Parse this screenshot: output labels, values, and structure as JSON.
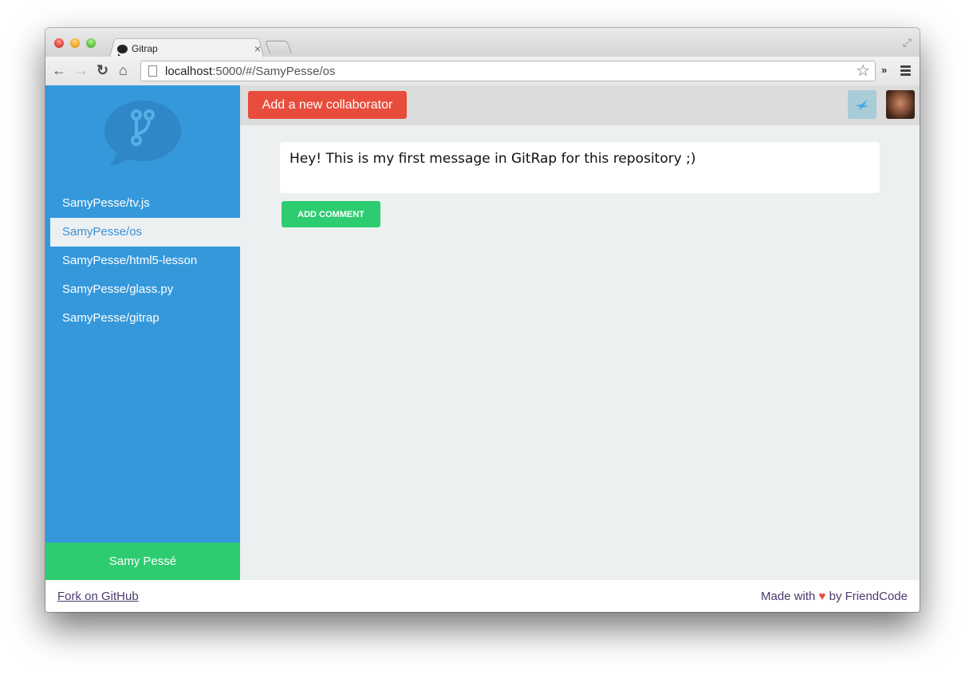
{
  "browser": {
    "tab_title": "Gitrap",
    "tab_close": "×",
    "url_host": "localhost",
    "url_rest": ":5000/#/SamyPesse/os",
    "icons": {
      "back": "←",
      "forward": "→",
      "reload": "↻",
      "home": "⌂",
      "star": "☆",
      "extensions": "»",
      "fullscreen": "⤢"
    }
  },
  "sidebar": {
    "repos": [
      {
        "label": "SamyPesse/tv.js",
        "active": false
      },
      {
        "label": "SamyPesse/os",
        "active": true
      },
      {
        "label": "SamyPesse/html5-lesson",
        "active": false
      },
      {
        "label": "SamyPesse/glass.py",
        "active": false
      },
      {
        "label": "SamyPesse/gitrap",
        "active": false
      }
    ],
    "user_name": "Samy Pessé"
  },
  "topbar": {
    "add_collaborator_label": "Add a new collaborator"
  },
  "comment": {
    "value": "Hey! This is my first message in GitRap for this repository ;)",
    "submit_label": "Add comment"
  },
  "footer": {
    "fork_link": "Fork on GitHub",
    "made_with": "Made with",
    "heart": "♥",
    "by_text": "by FriendCode"
  },
  "colors": {
    "sidebar_blue": "#3498db",
    "accent_red": "#e74c3c",
    "accent_green": "#2ecc71",
    "content_bg": "#ecf0f1"
  }
}
